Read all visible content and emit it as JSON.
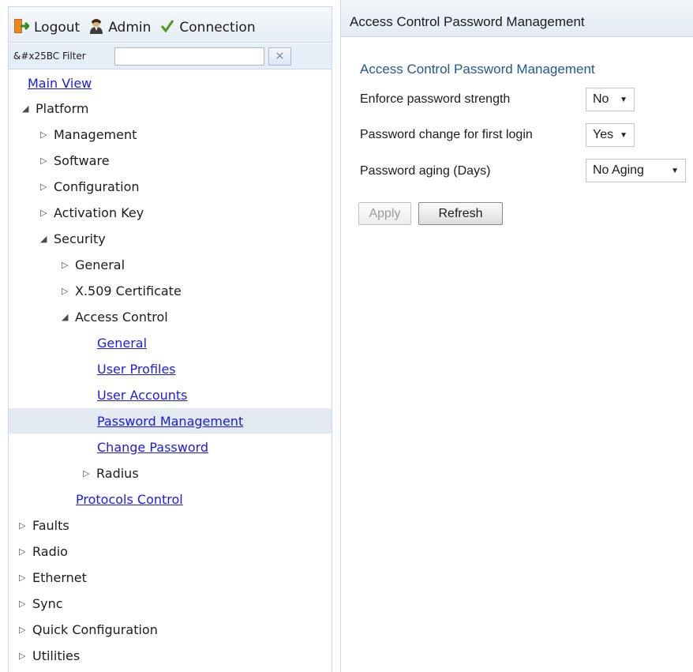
{
  "toolbar": {
    "logout_label": "Logout",
    "admin_label": "Admin",
    "connection_label": "Connection"
  },
  "filter": {
    "label": "&#x25BC Filter",
    "value": "",
    "clear_symbol": "×"
  },
  "tree": {
    "main_view": "Main View",
    "platform": "Platform",
    "management": "Management",
    "software": "Software",
    "configuration": "Configuration",
    "activation_key": "Activation Key",
    "security": "Security",
    "general": "General",
    "x509": "X.509 Certificate",
    "access_control": "Access Control",
    "ac_general": "General",
    "user_profiles": "User Profiles",
    "user_accounts": "User Accounts",
    "password_management": "Password Management",
    "change_password": "Change Password",
    "radius": "Radius",
    "protocols_control": "Protocols Control",
    "faults": "Faults",
    "radio": "Radio",
    "ethernet": "Ethernet",
    "sync": "Sync",
    "quick_configuration": "Quick Configuration",
    "utilities": "Utilities"
  },
  "main": {
    "header_title": "Access Control Password Management",
    "section_title": "Access Control Password Management",
    "fields": {
      "enforce_label": "Enforce password strength",
      "enforce_value": "No",
      "first_login_label": "Password change for first login",
      "first_login_value": "Yes",
      "aging_label": "Password aging (Days)",
      "aging_value": "No Aging"
    },
    "apply_label": "Apply",
    "refresh_label": "Refresh"
  },
  "colors": {
    "link": "#1a1aee",
    "section_title": "#245891",
    "selected_row": "#e4eaf1",
    "border": "#c8d8ea"
  },
  "icons": {
    "logout": "logout-door-icon",
    "admin": "admin-user-icon",
    "connection": "connection-checkmark-icon",
    "expanded": "triangle-expanded-icon",
    "collapsed": "triangle-collapsed-icon",
    "dropdown": "caret-down-icon"
  }
}
